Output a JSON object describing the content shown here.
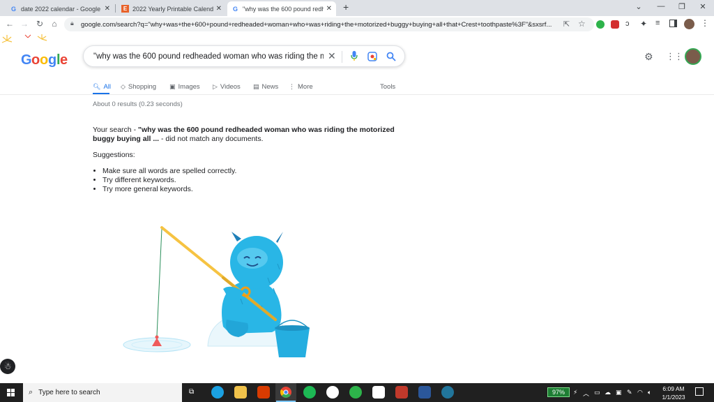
{
  "tabs": [
    {
      "title": "date 2022 calendar - Google Sea",
      "favicon": "google-favicon"
    },
    {
      "title": "2022 Yearly Printable Calendar. V",
      "favicon": "E"
    },
    {
      "title": "\"why was the 600 pound redhea",
      "favicon": "google-favicon"
    }
  ],
  "new_tab": "+",
  "window_controls": {
    "min": "—",
    "restore": "❐",
    "close": "✕",
    "dropdown": "⌄"
  },
  "url": "google.com/search?q=\"why+was+the+600+pound+redheaded+woman+who+was+riding+the+motorized+buggy+buying+all+that+Crest+toothpaste%3F\"&sxsrf...",
  "search": {
    "query": "\"why was the 600 pound redheaded woman who was riding the motori"
  },
  "nav": {
    "all": "All",
    "shopping": "Shopping",
    "images": "Images",
    "videos": "Videos",
    "news": "News",
    "more": "More",
    "tools": "Tools"
  },
  "result_stats": "About 0 results (0.23 seconds)",
  "no_match": {
    "prefix": "Your search - ",
    "query": "\"why was the 600 pound redheaded woman who was riding the motorized buggy buying all ...",
    "suffix": " - did not match any documents."
  },
  "suggestions_title": "Suggestions:",
  "suggestions": [
    "Make sure all words are spelled correctly.",
    "Try different keywords.",
    "Try more general keywords."
  ],
  "taskbar": {
    "search_placeholder": "Type here to search",
    "battery": "97%",
    "time": "6:09 AM",
    "date": "1/1/2023"
  },
  "colors": {
    "accent": "#1a73e8",
    "monster": "#29b6e6",
    "rod": "#f6c342",
    "bucket": "#25aee0"
  }
}
